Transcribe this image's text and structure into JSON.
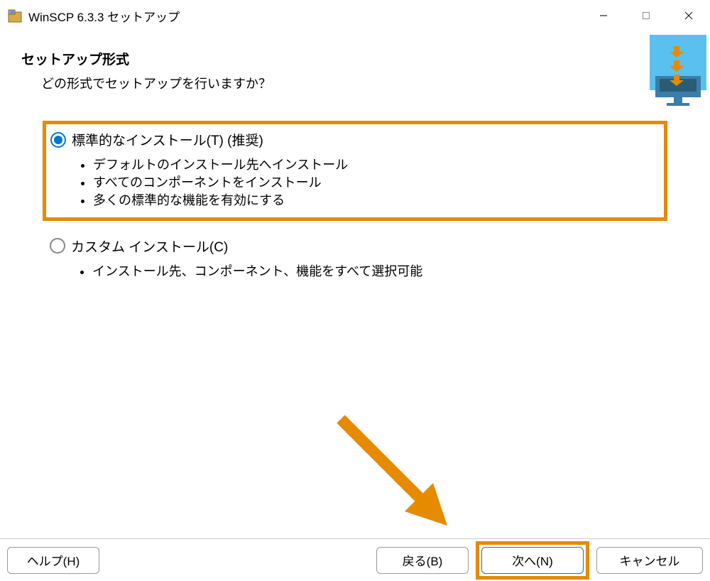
{
  "titlebar": {
    "title": "WinSCP 6.3.3 セットアップ"
  },
  "header": {
    "title": "セットアップ形式",
    "subtitle": "どの形式でセットアップを行いますか？"
  },
  "options": {
    "standard": {
      "label": "標準的なインストール(T) (推奨)",
      "bullets": [
        "デフォルトのインストール先へインストール",
        "すべてのコンポーネントをインストール",
        "多くの標準的な機能を有効にする"
      ]
    },
    "custom": {
      "label": "カスタム インストール(C)",
      "bullets": [
        "インストール先、コンポーネント、機能をすべて選択可能"
      ]
    }
  },
  "footer": {
    "help": "ヘルプ(H)",
    "back": "戻る(B)",
    "next": "次へ(N)",
    "cancel": "キャンセル"
  },
  "colors": {
    "accent": "#0078d4",
    "highlight": "#e68a00"
  }
}
